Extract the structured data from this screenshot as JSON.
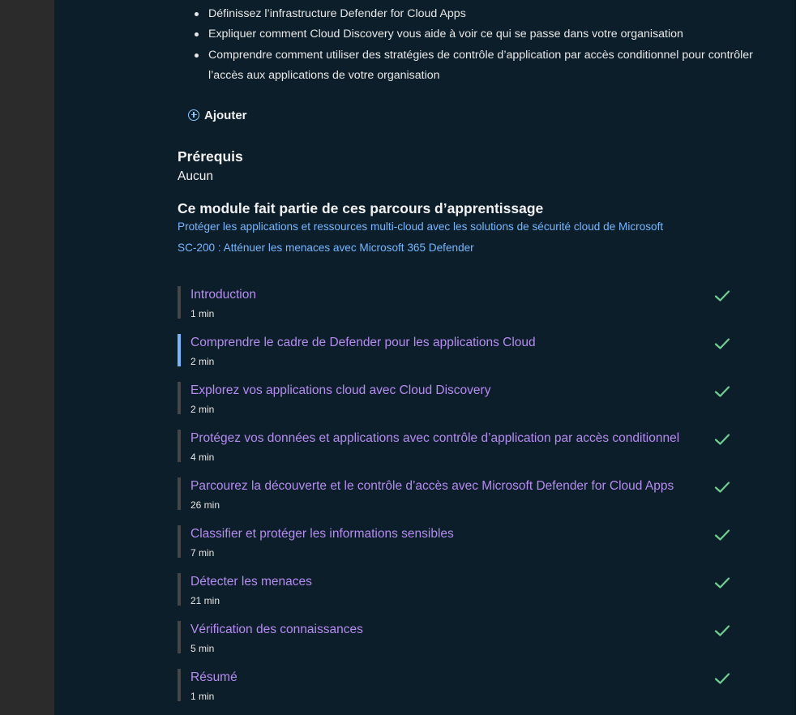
{
  "objectives": [
    "Définissez l’infrastructure Defender for Cloud Apps",
    "Expliquer comment Cloud Discovery vous aide à voir ce qui se passe dans votre organisation",
    "Comprendre comment utiliser des stratégies de contrôle d’application par accès conditionnel pour contrôler l’accès aux applications de votre organisation"
  ],
  "add_button": {
    "label": "Ajouter",
    "icon": "plus-circle-icon"
  },
  "prerequisites": {
    "heading": "Prérequis",
    "value": "Aucun"
  },
  "learning_paths": {
    "heading": "Ce module fait partie de ces parcours d’apprentissage",
    "links": [
      "Protéger les applications et ressources multi-cloud avec les solutions de sécurité cloud de Microsoft",
      "SC-200 : Atténuer les menaces avec Microsoft 365 Defender"
    ]
  },
  "units": [
    {
      "title": "Introduction",
      "duration": "1 min",
      "completed": true,
      "active": false
    },
    {
      "title": "Comprendre le cadre de Defender pour les applications Cloud",
      "duration": "2 min",
      "completed": true,
      "active": true
    },
    {
      "title": "Explorez vos applications cloud avec Cloud Discovery",
      "duration": "2 min",
      "completed": true,
      "active": false
    },
    {
      "title": "Protégez vos données et applications avec contrôle d’application par accès conditionnel",
      "duration": "4 min",
      "completed": true,
      "active": false
    },
    {
      "title": "Parcourez la découverte et le contrôle d’accès avec Microsoft Defender for Cloud Apps",
      "duration": "26 min",
      "completed": true,
      "active": false
    },
    {
      "title": "Classifier et protéger les informations sensibles",
      "duration": "7 min",
      "completed": true,
      "active": false
    },
    {
      "title": "Détecter les menaces",
      "duration": "21 min",
      "completed": true,
      "active": false
    },
    {
      "title": "Vérification des connaissances",
      "duration": "5 min",
      "completed": true,
      "active": false
    },
    {
      "title": "Résumé",
      "duration": "1 min",
      "completed": true,
      "active": false
    }
  ],
  "colors": {
    "background": "#0c1e29",
    "unit_title": "#b58cf0",
    "link": "#75b6ff",
    "check": "#6fcf8f",
    "active_bar": "#75b6ff"
  }
}
